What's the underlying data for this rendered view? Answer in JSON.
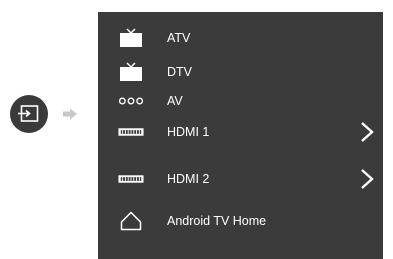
{
  "input_menu": {
    "items": [
      {
        "label": "ATV",
        "icon": "tv-icon",
        "has_submenu": false
      },
      {
        "label": "DTV",
        "icon": "tv-icon",
        "has_submenu": false
      },
      {
        "label": "AV",
        "icon": "av-connector-icon",
        "has_submenu": false
      },
      {
        "label": "HDMI 1",
        "icon": "hdmi-port-icon",
        "has_submenu": true
      },
      {
        "label": "HDMI 2",
        "icon": "hdmi-port-icon",
        "has_submenu": true
      },
      {
        "label": "Android TV Home",
        "icon": "home-icon",
        "has_submenu": false
      }
    ]
  },
  "colors": {
    "panel_background": "#3b3b3b",
    "input_button_background": "#3a3a3a",
    "text": "#ffffff",
    "arrow_indicator": "#c8c8c8"
  }
}
